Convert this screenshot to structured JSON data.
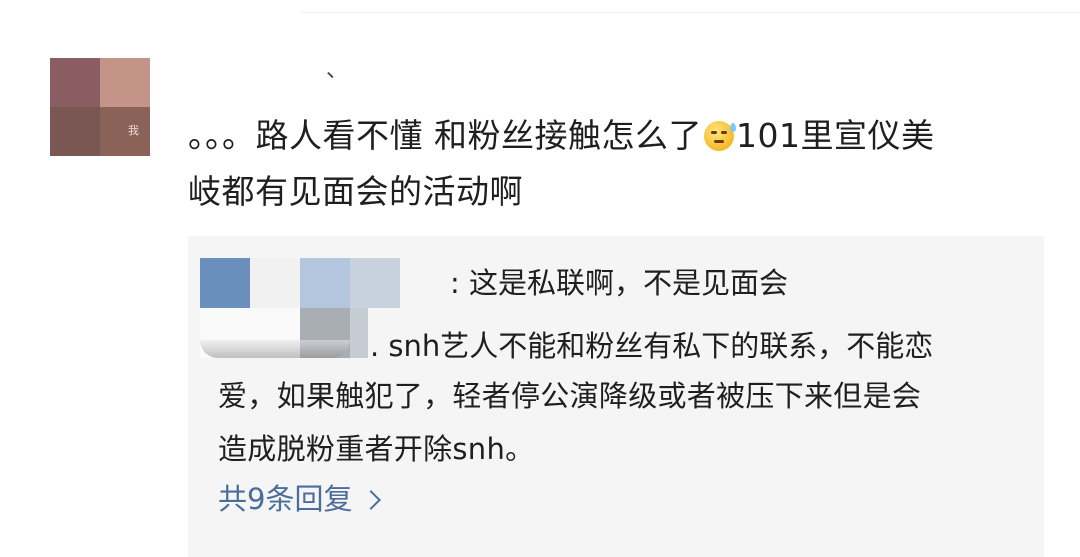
{
  "comment": {
    "avatar_badge": "我",
    "username_mark": "、",
    "text_before_emoji": "。。。路人看不懂 和粉丝接触怎么了",
    "emoji_icon": "sweat-smile-emoji",
    "text_after_emoji": "101里宣仪美",
    "text_line2": "岐都有见面会的活动啊"
  },
  "reply": {
    "line1": ": 这是私联啊，不是见面会",
    "line2": ". snh艺人不能和粉丝有私下的联系，不能恋",
    "line3": "爱，如果触犯了，轻者停公演降级或者被压下来但是会",
    "line4": "造成脱粉重者开除snh。",
    "more_replies_label": "共9条回复"
  },
  "colors": {
    "link": "#4b6d9b",
    "text": "#1f1f1f",
    "reply_bg": "#f5f5f5"
  }
}
